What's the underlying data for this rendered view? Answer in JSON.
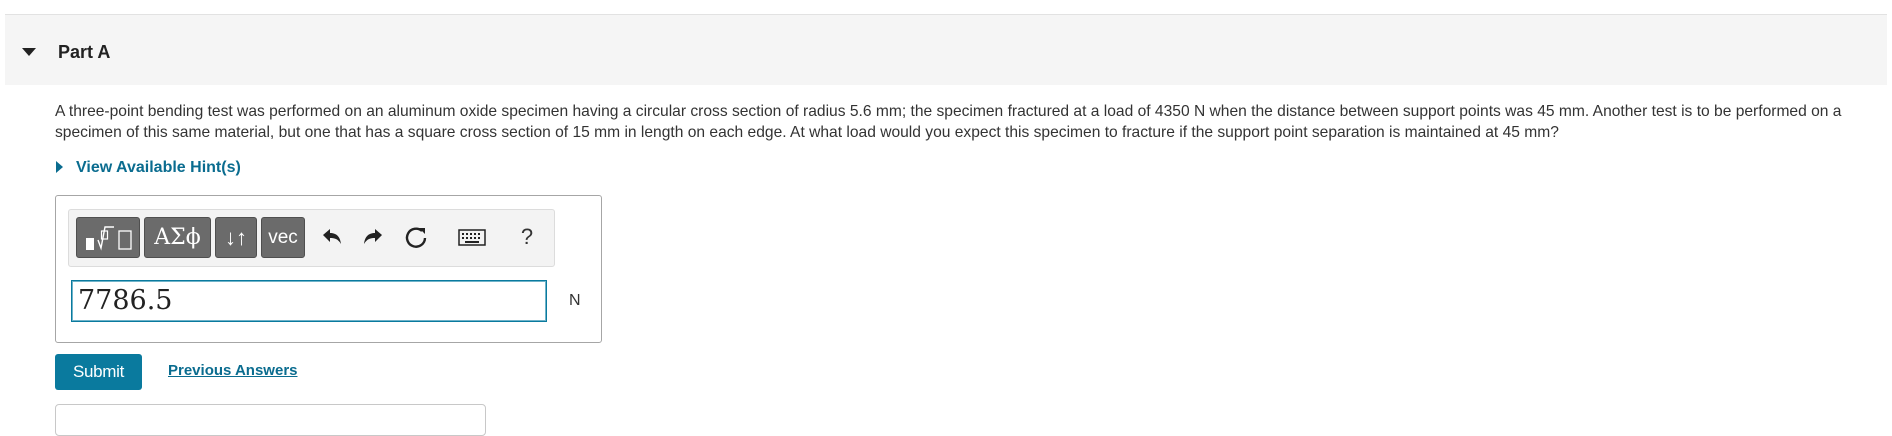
{
  "part": {
    "title": "Part A"
  },
  "question": {
    "text": "A three-point bending test was performed on an aluminum oxide specimen having a circular cross section of radius 5.6 mm; the specimen fractured at a load of 4350 N when the distance between support points was 45 mm.  Another test is to be performed on a specimen of this same material, but one that has a square cross section of 15 mm in length on each edge.  At what load would you expect this specimen to fracture if the support point separation is maintained at 45 mm?"
  },
  "hints": {
    "label": "View Available Hint(s)"
  },
  "toolbar": {
    "symbols_label": "ΑΣϕ",
    "updown_label": "↓↑",
    "vec_label": "vec",
    "help_label": "?"
  },
  "answer": {
    "value": "7786.5",
    "unit": "N"
  },
  "actions": {
    "submit_label": "Submit",
    "previous_answers_label": "Previous Answers"
  },
  "colors": {
    "accent": "#0a7a9e",
    "link": "#0a6c8f",
    "toolbar_button": "#6b6b6b",
    "header_bg": "#f5f5f5"
  }
}
